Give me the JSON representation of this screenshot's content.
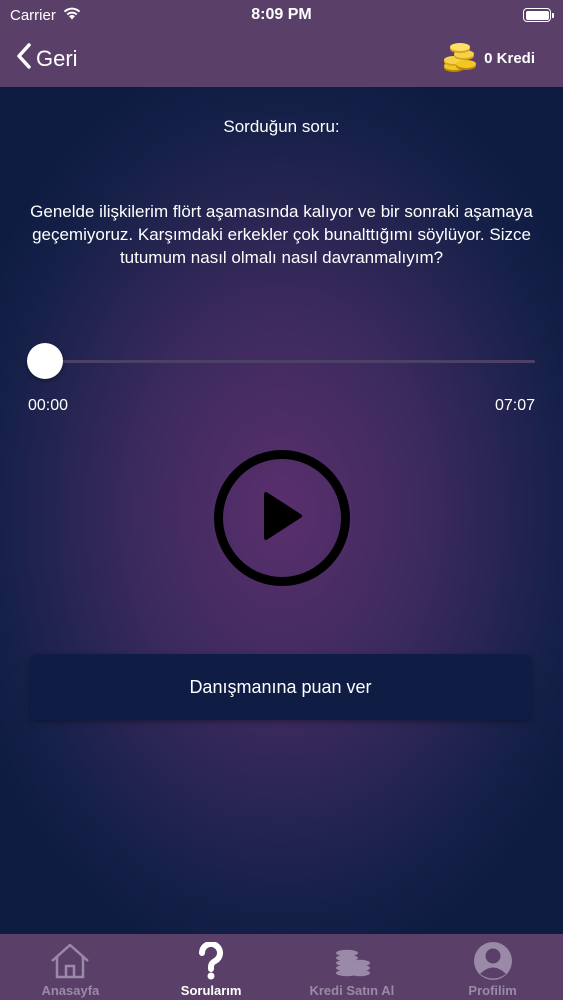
{
  "status_bar": {
    "carrier": "Carrier",
    "time": "8:09 PM"
  },
  "nav": {
    "back_label": "Geri",
    "credit_label": "0 Kredi"
  },
  "question": {
    "label": "Sorduğun soru:",
    "text": "Genelde ilişkilerim flört aşamasında kalıyor ve bir sonraki aşamaya geçemiyoruz. Karşımdaki erkekler çok bunalttığımı söylüyor. Sizce tutumum nasıl olmalı nasıl davranmalıyım?"
  },
  "player": {
    "current_time": "00:00",
    "total_time": "07:07",
    "progress": 0
  },
  "rate_button": {
    "label": "Danışmanına puan ver"
  },
  "tabs": [
    {
      "label": "Anasayfa",
      "icon": "home-icon",
      "active": false
    },
    {
      "label": "Sorularım",
      "icon": "question-mark-icon",
      "active": true
    },
    {
      "label": "Kredi Satın Al",
      "icon": "coins-icon",
      "active": false
    },
    {
      "label": "Profilim",
      "icon": "profile-icon",
      "active": false
    }
  ],
  "colors": {
    "bar": "#5a3f69",
    "background": "#0d1a3b",
    "tab_inactive": "#9b8aa7",
    "button": "#0f1c44"
  }
}
